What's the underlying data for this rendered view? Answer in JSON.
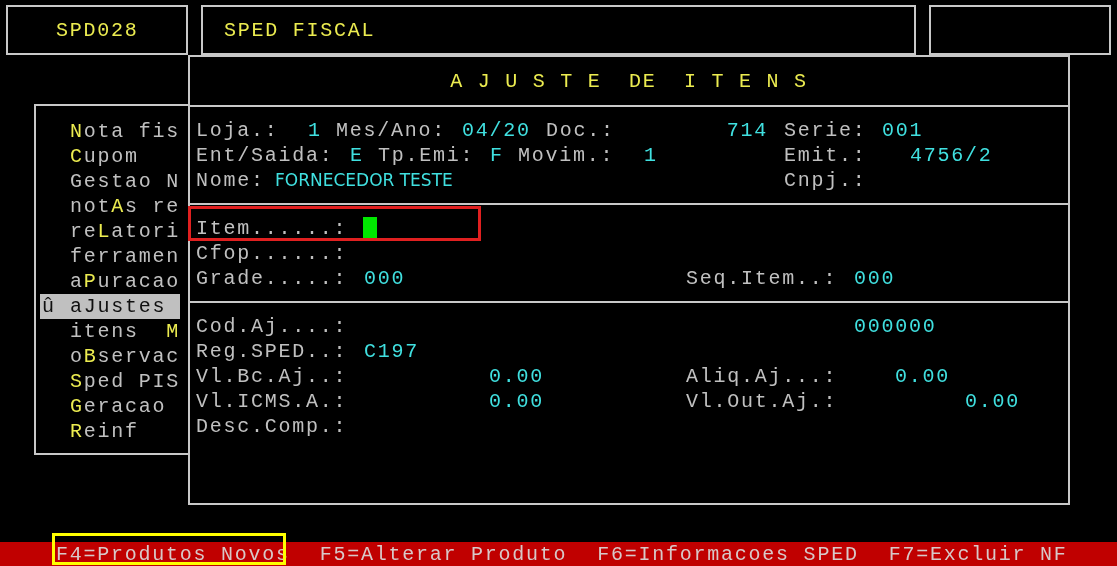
{
  "header": {
    "program_code": "SPD028",
    "system_title": "SPED FISCAL"
  },
  "menu": {
    "items": [
      {
        "hotkey": "N",
        "after": "ota fis",
        "selected": false
      },
      {
        "hotkey": "C",
        "after": "upom",
        "selected": false
      },
      {
        "before": "Gestao N",
        "selected": false
      },
      {
        "before": "not",
        "hotkey": "A",
        "after": "s re",
        "selected": false
      },
      {
        "before": "re",
        "hotkey": "L",
        "after": "atori",
        "selected": false
      },
      {
        "before": "ferramen",
        "selected": false
      },
      {
        "before": "a",
        "hotkey": "P",
        "after": "uracao",
        "selected": false
      },
      {
        "marker": "û",
        "before": "a",
        "hotkey": "J",
        "after": "ustes",
        "selected": true
      },
      {
        "before": "itens  ",
        "hotkey": "M",
        "selected": false
      },
      {
        "before": "o",
        "hotkey": "B",
        "after": "servac",
        "selected": false
      },
      {
        "hotkey": "S",
        "after": "ped PIS",
        "selected": false
      },
      {
        "hotkey": "G",
        "after": "eracao",
        "selected": false
      },
      {
        "hotkey": "R",
        "after": "einf",
        "selected": false
      }
    ]
  },
  "dialog": {
    "title": "A J U S T E  DE  I T E N S",
    "sections": [
      {
        "rows": [
          {
            "left": [
              {
                "kind": "text",
                "label": "Loja.:",
                "value": "1"
              },
              {
                "kind": "text",
                "label": "Mes/Ano:",
                "value": "04/20"
              },
              {
                "kind": "text",
                "label": "Doc.:",
                "value": "714"
              }
            ],
            "right": [
              {
                "kind": "text",
                "label": "Serie:",
                "value": "001"
              }
            ]
          },
          {
            "left": [
              {
                "kind": "text",
                "label": "Ent/Saida:",
                "value": "E"
              },
              {
                "kind": "text",
                "label": "Tp.Emi:",
                "value": "F"
              },
              {
                "kind": "text",
                "label": "Movim.:",
                "value": "1"
              }
            ],
            "right": [
              {
                "kind": "text",
                "label": "Emit.:",
                "value": "4756/2"
              }
            ]
          },
          {
            "left": [
              {
                "kind": "name",
                "label": "Nome:",
                "value": "FORNECEDOR TESTE"
              }
            ],
            "right": [
              {
                "kind": "text",
                "label": "Cnpj.:"
              }
            ]
          }
        ]
      },
      {
        "rows": [
          {
            "left": [
              {
                "kind": "input",
                "label": "Item......:",
                "focused": true,
                "annotated": true
              }
            ]
          },
          {
            "left": [
              {
                "kind": "text",
                "label": "Cfop......:"
              }
            ]
          },
          {
            "left": [
              {
                "kind": "text",
                "label": "Grade.....:",
                "value": "000"
              }
            ],
            "right": [
              {
                "kind": "text",
                "label": "Seq.Item..:",
                "value": "000"
              }
            ]
          }
        ]
      },
      {
        "rows": [
          {
            "left": [
              {
                "kind": "text",
                "label": "Cod.Aj....:",
                "value": "000000"
              }
            ]
          },
          {
            "left": [
              {
                "kind": "text",
                "label": "Reg.SPED..:",
                "value": "C197"
              }
            ]
          },
          {
            "left": [
              {
                "kind": "text",
                "label": "Vl.Bc.Aj..:",
                "value": "0.00"
              }
            ],
            "right": [
              {
                "kind": "text",
                "label": "Aliq.Aj...:",
                "value": "0.00"
              }
            ]
          },
          {
            "left": [
              {
                "kind": "text",
                "label": "Vl.ICMS.A.:",
                "value": "0.00"
              }
            ],
            "right": [
              {
                "kind": "text",
                "label": "Vl.Out.Aj.:",
                "value": "0.00"
              }
            ]
          },
          {
            "left": [
              {
                "kind": "text",
                "label": "Desc.Comp.:"
              }
            ]
          }
        ]
      }
    ]
  },
  "function_keys": [
    {
      "text": "F4=Produtos Novos",
      "annotated": true
    },
    {
      "text": "F5=Alterar Produto",
      "annotated": false
    },
    {
      "text": "F6=Informacoes SPED",
      "annotated": false
    },
    {
      "text": "F7=Excluir NF",
      "annotated": false
    }
  ]
}
